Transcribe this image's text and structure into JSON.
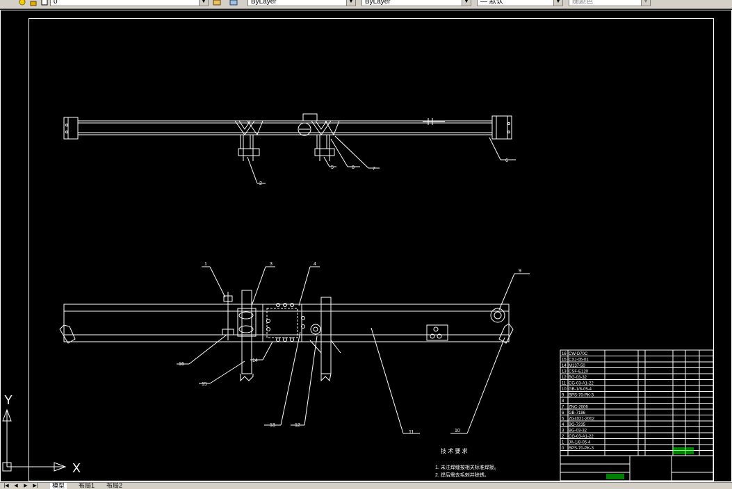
{
  "toolbar": {
    "layer_value": "0",
    "color_value": "ByLayer",
    "linetype_value": "ByLayer",
    "lineweight_value": "— 默认",
    "plotstyle_value": "随颜色"
  },
  "drawing": {
    "top_callouts": [
      "2",
      "5",
      "8",
      "7",
      "6"
    ],
    "bottom_callouts": [
      "1",
      "3",
      "4",
      "9",
      "16",
      "14",
      "15",
      "13",
      "12",
      "11",
      "10"
    ],
    "tech_title": "技 术 要 求",
    "tech_notes": [
      "1. 未注焊缝按相关标准焊接。",
      "2. 焊后需去毛刺并除锈。"
    ],
    "bom_rows": [
      {
        "no": "16",
        "code": "CW-D70C"
      },
      {
        "no": "15",
        "code": "CXJ-05-01"
      },
      {
        "no": "14",
        "code": "M137-50"
      },
      {
        "no": "13",
        "code": "CSF-E120"
      },
      {
        "no": "12",
        "code": "BG-03-32"
      },
      {
        "no": "11",
        "code": "CG-03-A1-22"
      },
      {
        "no": "10",
        "code": "GB-1/8-05-4"
      },
      {
        "no": "9",
        "code": "BPS-70-PK-3"
      },
      {
        "no": "8",
        "code": ""
      },
      {
        "no": "7",
        "code": "ZNC-2006"
      },
      {
        "no": "6",
        "code": "GB-7186"
      },
      {
        "no": "5",
        "code": "ZG4021-2002"
      },
      {
        "no": "4",
        "code": "BG-7235"
      },
      {
        "no": "3",
        "code": "BG-03-32"
      },
      {
        "no": "2",
        "code": "CG-03-A1-22"
      },
      {
        "no": "1",
        "code": "JA-1/8-05-4"
      },
      {
        "no": "0",
        "code": "BPS-70-PK-3"
      }
    ]
  },
  "ucs": {
    "x_label": "X",
    "y_label": "Y"
  },
  "tabs": {
    "model": "模型",
    "layout1": "布局1",
    "layout2": "布局2"
  }
}
